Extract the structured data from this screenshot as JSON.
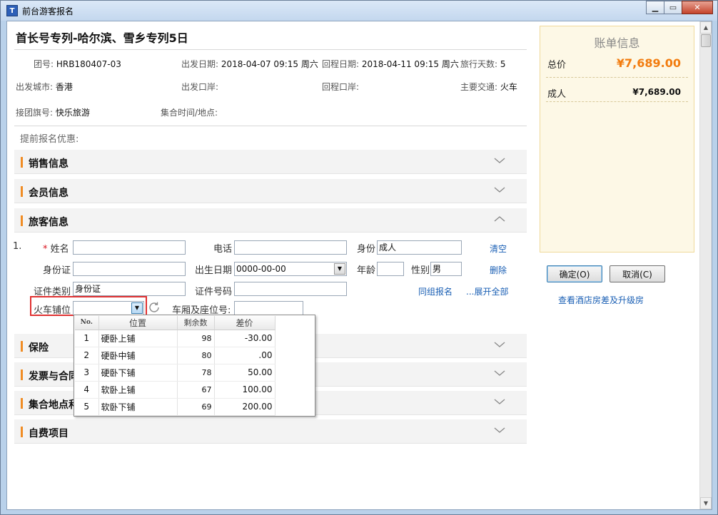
{
  "window": {
    "title": "前台游客报名",
    "icon": "app-icon",
    "controls": [
      "minimize",
      "maximize",
      "close"
    ]
  },
  "trip": {
    "title": "首长号专列-哈尔滨、雪乡专列5日",
    "group_no_label": "团号:",
    "group_no": "HRB180407-03",
    "depart_date_label": "出发日期:",
    "depart_date": "2018-04-07 09:15 周六",
    "return_date_label": "回程日期:",
    "return_date": "2018-04-11 09:15 周六",
    "days_label": "旅行天数:",
    "days": "5",
    "depart_city_label": "出发城市:",
    "depart_city": "香港",
    "depart_port_label": "出发口岸:",
    "depart_port": "",
    "return_port_label": "回程口岸:",
    "return_port": "",
    "transport_label": "主要交通:",
    "transport": "火车",
    "flag_label": "接团旗号:",
    "flag": "快乐旅游",
    "meet_label": "集合时间/地点:",
    "meet": "",
    "promo_label": "提前报名优惠:"
  },
  "sections": {
    "sales": "销售信息",
    "member": "会员信息",
    "traveler": "旅客信息",
    "insurance": "保险",
    "invoice": "发票与合同",
    "meeting": "集合地点和",
    "selfpay": "自费项目"
  },
  "traveler": {
    "index": "1.",
    "name_label": "姓名",
    "name_required": "*",
    "name": "",
    "phone_label": "电话",
    "phone": "",
    "identity_label": "身份",
    "identity": "成人",
    "clear_link": "清空",
    "id_card_label": "身份证",
    "id_card": "",
    "birth_label": "出生日期",
    "birth": "0000-00-00",
    "age_label": "年龄",
    "age": "",
    "gender_label": "性别",
    "gender": "男",
    "delete_link": "删除",
    "doc_type_label": "证件类别",
    "doc_type": "身份证",
    "doc_no_label": "证件号码",
    "doc_no": "",
    "same_group_link": "同组报名",
    "expand_all_link": "...展开全部",
    "berth_label": "火车铺位",
    "berth": "",
    "seat_label": "车厢及座位号:",
    "seat": ""
  },
  "berth_dropdown": {
    "headers": {
      "no": "No.",
      "position": "位置",
      "remaining": "剩余数",
      "diff": "差价"
    },
    "rows": [
      {
        "no": "1",
        "position": "硬卧上铺",
        "remaining": "98",
        "diff": "-30.00"
      },
      {
        "no": "2",
        "position": "硬卧中铺",
        "remaining": "80",
        "diff": ".00"
      },
      {
        "no": "3",
        "position": "硬卧下铺",
        "remaining": "78",
        "diff": "50.00"
      },
      {
        "no": "4",
        "position": "软卧上铺",
        "remaining": "67",
        "diff": "100.00"
      },
      {
        "no": "5",
        "position": "软卧下铺",
        "remaining": "69",
        "diff": "200.00"
      }
    ]
  },
  "bill": {
    "title": "账单信息",
    "total_label": "总价",
    "total": "¥7,689.00",
    "adult_label": "成人",
    "adult": "¥7,689.00"
  },
  "actions": {
    "confirm": "确定(O)",
    "cancel": "取消(C)",
    "hotel_link": "查看酒店房差及升级房"
  },
  "colors": {
    "accent": "#f08c24",
    "price": "#f27c0f",
    "link": "#1a5fb4",
    "highlight": "#e03131",
    "bill_bg": "#fdf8e6"
  }
}
